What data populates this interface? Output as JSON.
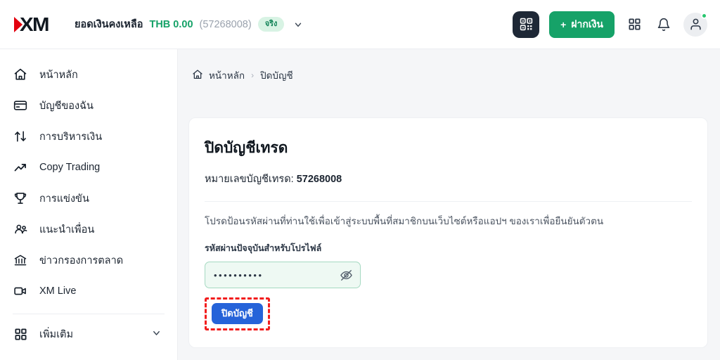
{
  "header": {
    "logo_text": "XM",
    "balance_label": "ยอดเงินคงเหลือ",
    "balance_value": "THB 0.00",
    "account_number": "(57268008)",
    "account_type_badge": "จริง",
    "deposit_label": "ฝากเงิน",
    "deposit_plus": "+",
    "icons": {
      "qr": "qr-code-icon",
      "apps": "grid-apps-icon",
      "bell": "notification-bell-icon",
      "avatar": "user-avatar-icon",
      "chevron": "chevron-down-icon"
    },
    "colors": {
      "accent_green": "#16a268",
      "badge_bg": "#d8f3e4",
      "qr_bg": "#1e2836",
      "status_dot": "#28c76f"
    }
  },
  "sidebar": {
    "items": [
      {
        "label": "หน้าหลัก",
        "icon": "home-icon"
      },
      {
        "label": "บัญชีของฉัน",
        "icon": "card-icon"
      },
      {
        "label": "การบริหารเงิน",
        "icon": "transfer-arrows-icon"
      },
      {
        "label": "Copy Trading",
        "icon": "trending-up-icon"
      },
      {
        "label": "การแข่งขัน",
        "icon": "trophy-icon"
      },
      {
        "label": "แนะนำเพื่อน",
        "icon": "people-group-icon"
      },
      {
        "label": "ข่าวกรองการตลาด",
        "icon": "bank-building-icon"
      },
      {
        "label": "XM Live",
        "icon": "video-camera-icon"
      }
    ],
    "more": {
      "label": "เพิ่มเติม",
      "icon": "grid-apps-icon",
      "chevron": "chevron-down-icon"
    }
  },
  "breadcrumb": {
    "home": "หน้าหลัก",
    "home_icon": "home-icon",
    "separator": "›",
    "current": "ปิดบัญชี"
  },
  "card": {
    "title": "ปิดบัญชีเทรด",
    "account_label": "หมายเลขบัญชีเทรด:",
    "account_number": "57268008",
    "instruction": "โปรดป้อนรหัสผ่านที่ท่านใช้เพื่อเข้าสู่ระบบพื้นที่สมาชิกบนเว็บไซต์หรือแอปฯ ของเราเพื่อยืนยันตัวตน",
    "password_label": "รหัสผ่านปัจจุบันสำหรับโปรไฟล์",
    "password_value": "••••••••••",
    "password_placeholder": "",
    "toggle_icon": "eye-off-icon",
    "submit_label": "ปิดบัญชี",
    "submit_color": "#2563d9",
    "highlight_color": "#f21d1d"
  }
}
